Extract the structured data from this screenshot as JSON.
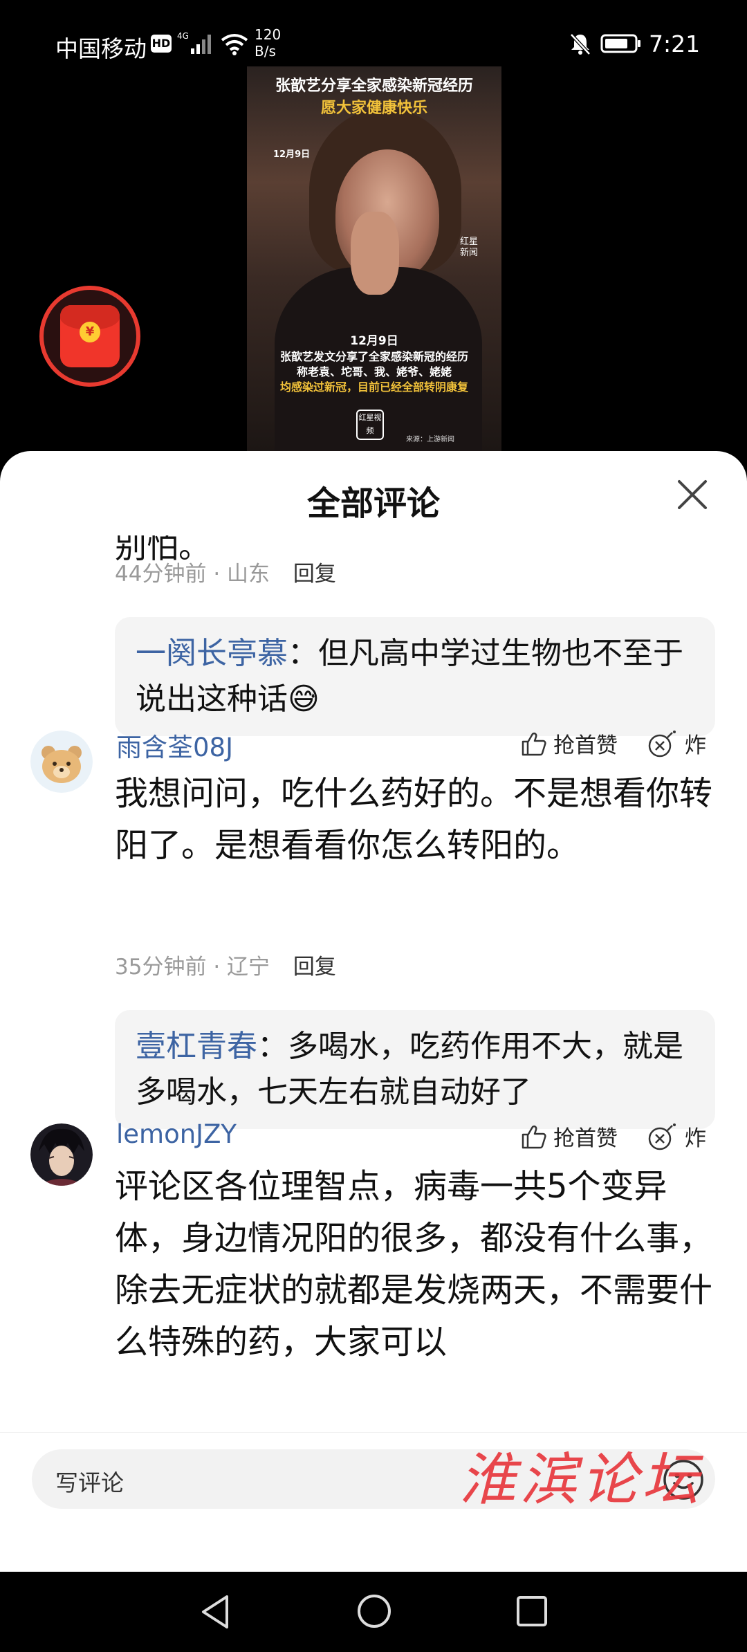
{
  "status_bar": {
    "carrier": "中国移动",
    "hd": "HD",
    "network": "4G",
    "speed_value": "120",
    "speed_unit": "B/s",
    "time": "7:21"
  },
  "video": {
    "title_line1": "张歆艺分享全家感染新冠经历",
    "title_line2": "愿大家健康快乐",
    "date_top": "12月9日",
    "badge_text": "红星新闻",
    "date_caption": "12月9日",
    "caption_line1": "张歆艺发文分享了全家感染新冠的经历",
    "caption_line2": "称老袁、坨哥、我、姥爷、姥姥",
    "caption_line3": "均感染过新冠，目前已经全部转阴康复",
    "logo_text": "红星视频",
    "source": "来源：上游新闻",
    "redpacket_symbol": "¥"
  },
  "sheet": {
    "title": "全部评论",
    "clipped_text": "别怕。"
  },
  "comments": [
    {
      "time": "44分钟前",
      "location": "山东",
      "reply_label": "回复",
      "reply_user": "一阕长亭慕",
      "reply_text": "：但凡高中学过生物也不至于说出这种话😅"
    },
    {
      "username": "雨含荃08J",
      "like_label": "抢首赞",
      "bomb_label": "炸",
      "text": "我想问问，吃什么药好的。不是想看你转阳了。是想看看你怎么转阳的。",
      "time": "35分钟前",
      "location": "辽宁",
      "reply_label": "回复",
      "reply_user": "壹杠青春",
      "reply_text": "：多喝水，吃药作用不大，就是多喝水，七天左右就自动好了"
    },
    {
      "username": "lemonJZY",
      "like_label": "抢首赞",
      "bomb_label": "炸",
      "text": "评论区各位理智点，病毒一共5个变异体，身边情况阳的很多，都没有什么事，除去无症状的就都是发烧两天，不需要什么特殊的药，大家可以"
    }
  ],
  "bottom": {
    "input_placeholder": "写评论",
    "watermark": "淮滨论坛"
  },
  "colors": {
    "username_blue": "#3d64a3",
    "meta_gray": "#999999",
    "reply_bg": "#f4f4f4",
    "redpacket_red": "#e83a30"
  }
}
